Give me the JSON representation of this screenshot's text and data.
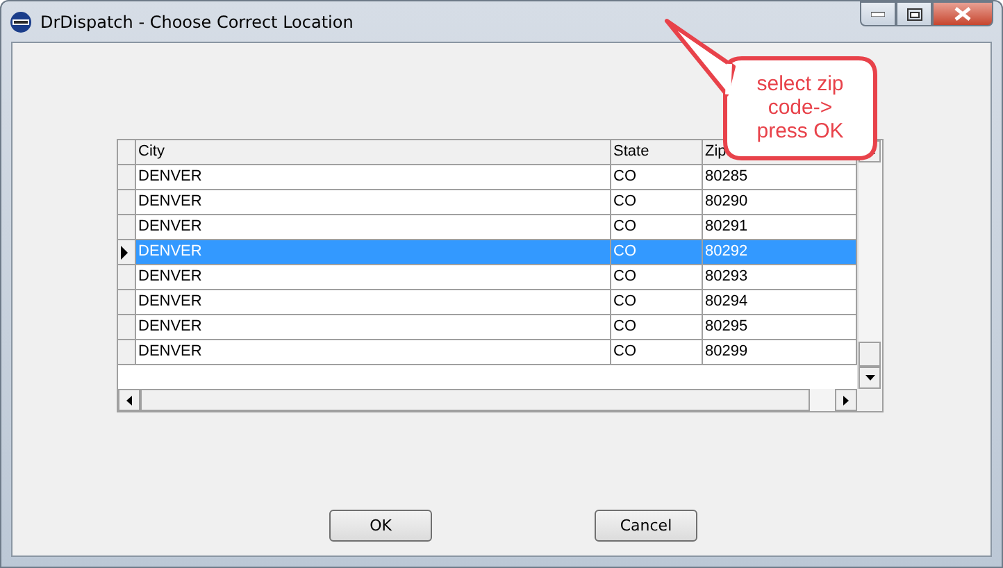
{
  "window": {
    "title": "DrDispatch - Choose Correct Location"
  },
  "table": {
    "columns": [
      "City",
      "State",
      "Zip"
    ],
    "rows": [
      {
        "cells": [
          "DENVER",
          "CO",
          "80285"
        ],
        "selected": false
      },
      {
        "cells": [
          "DENVER",
          "CO",
          "80290"
        ],
        "selected": false
      },
      {
        "cells": [
          "DENVER",
          "CO",
          "80291"
        ],
        "selected": false
      },
      {
        "cells": [
          "DENVER",
          "CO",
          "80292"
        ],
        "selected": true
      },
      {
        "cells": [
          "DENVER",
          "CO",
          "80293"
        ],
        "selected": false
      },
      {
        "cells": [
          "DENVER",
          "CO",
          "80294"
        ],
        "selected": false
      },
      {
        "cells": [
          "DENVER",
          "CO",
          "80295"
        ],
        "selected": false
      },
      {
        "cells": [
          "DENVER",
          "CO",
          "80299"
        ],
        "selected": false
      }
    ]
  },
  "buttons": [
    "OK",
    "Cancel"
  ],
  "callout": {
    "text": "select zip code-> press OK"
  }
}
